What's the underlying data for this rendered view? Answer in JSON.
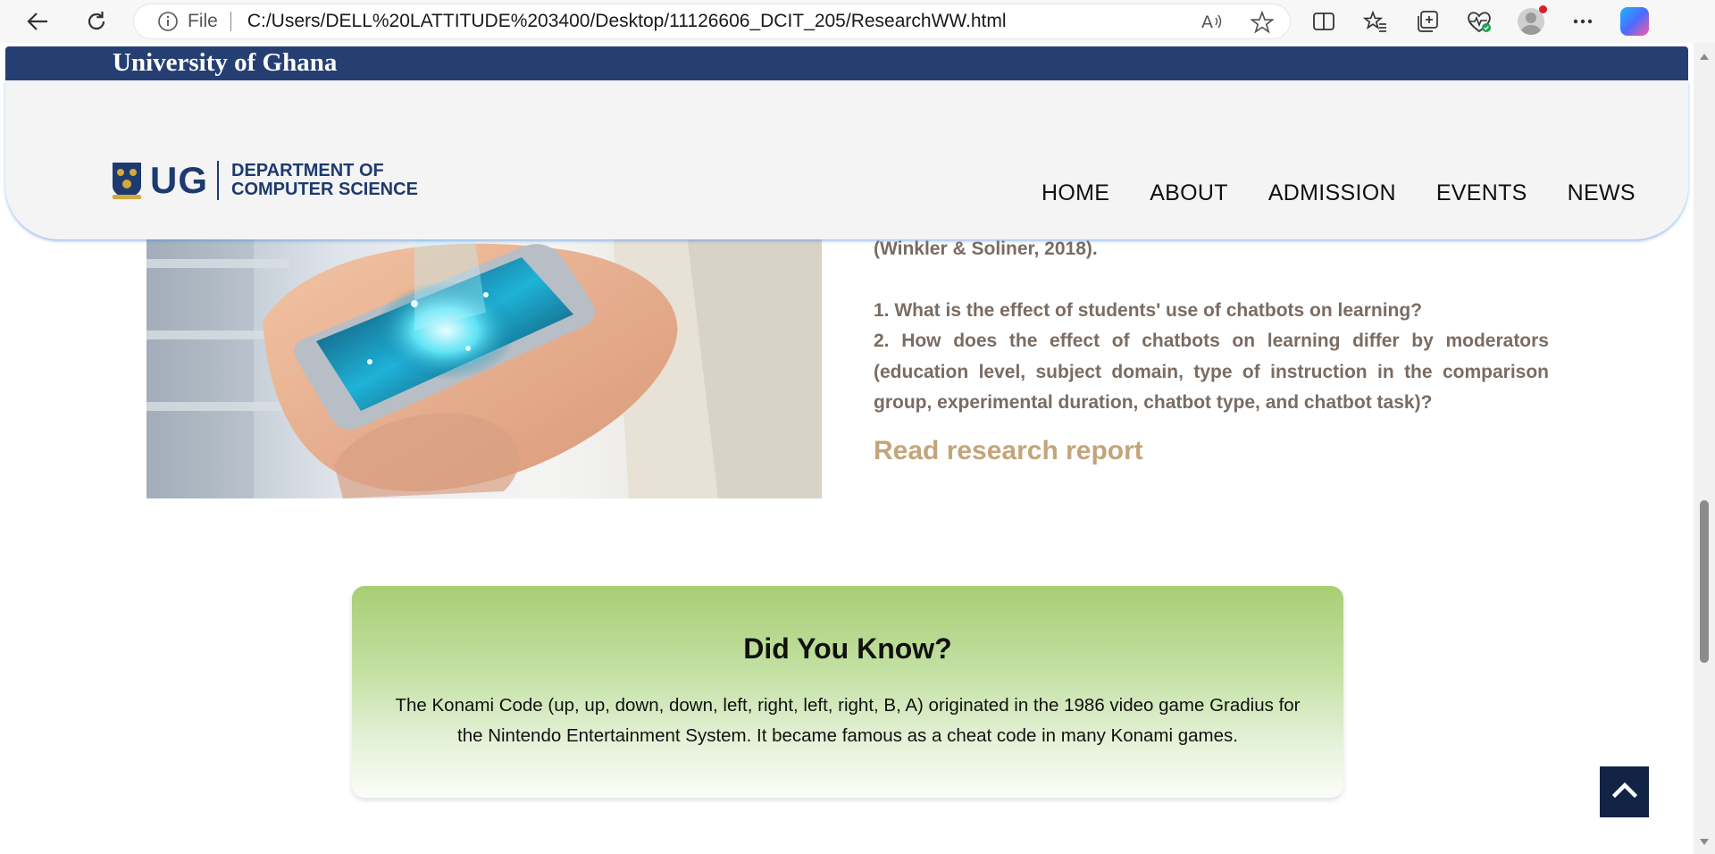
{
  "browser": {
    "file_label": "File",
    "url": "C:/Users/DELL%20LATTITUDE%203400/Desktop/11126606_DCIT_205/ResearchWW.html"
  },
  "site": {
    "university": "University of Ghana",
    "logo_ug": "UG",
    "dept_line1": "DEPARTMENT OF",
    "dept_line2": "COMPUTER SCIENCE",
    "nav": [
      "HOME",
      "ABOUT",
      "ADMISSION",
      "EVENTS",
      "NEWS"
    ]
  },
  "research": {
    "citation_line": "(Winkler & Soliner, 2018).",
    "question1": "1. What is the effect of students' use of chatbots on learning?",
    "question2": "2. How does the effect of chatbots on learning differ by moderators (education level, subject domain, type of instruction in the comparison group, experimental duration, chatbot type, and chatbot task)?",
    "read_link": "Read research report"
  },
  "did_you_know": {
    "title": "Did You Know?",
    "body": "The Konami Code (up, up, down, down, left, right, left, right, B, A) originated in the 1986 video game Gradius for the Nintendo Entertainment System. It became famous as a cheat code in many Konami games."
  },
  "colors": {
    "header_blue": "#253f73",
    "research_text": "#7a6c62",
    "link_gold": "#c3a57b",
    "card_green": "#a8ce74",
    "back_to_top": "#122446"
  }
}
